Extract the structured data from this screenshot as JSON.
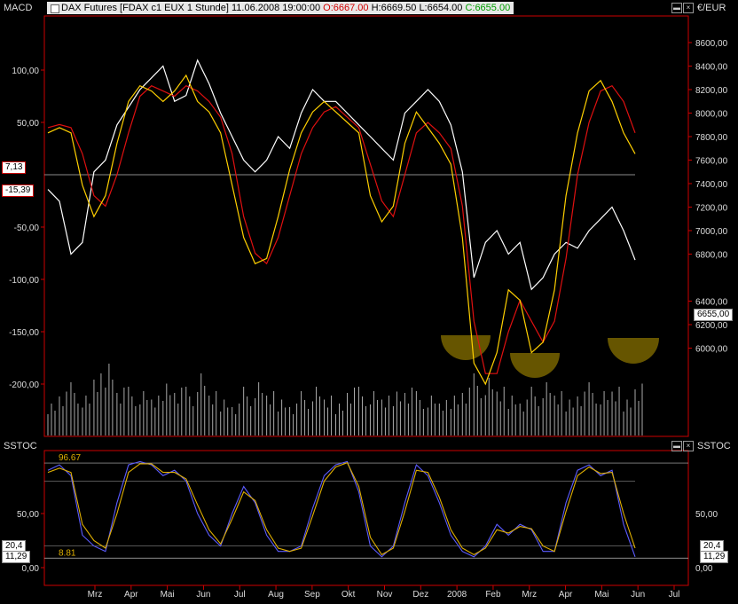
{
  "window": {
    "panel_top_label": "MACD",
    "panel_bottom_label": "SSTOC",
    "right_axis_label": "€/EUR",
    "right_bottom_label": "SSTOC"
  },
  "header": {
    "instrument": "DAX Futures [FDAX c1 EUX  1 Stunde]",
    "datetime": "11.06.2008 19:00:00",
    "open": "O:6667.00",
    "high": "H:6669.50",
    "low": "L:6654.00",
    "close": "C:6655.00"
  },
  "colors": {
    "price": "#ffffff",
    "macd": "#ffd000",
    "signal": "#e01010",
    "stoch_k": "#5b5bff",
    "stoch_d": "#e0b000",
    "highlight": "#6b5a00"
  },
  "tags": {
    "macd_value": "7,13",
    "signal_value": "-15,39",
    "last_price": "6655,00",
    "stoch_a_left": "20,4",
    "stoch_b_left": "11,29",
    "stoch_a_right": "20,4",
    "stoch_b_right": "11,29",
    "upper_level": "96.67",
    "lower_level": "8.81"
  },
  "chart_data": [
    {
      "type": "line",
      "panel": "MACD",
      "left_axis": {
        "ticks": [
          "100,00",
          "50,00",
          "-50,00",
          "-100,00",
          "-150,00",
          "-200,00"
        ],
        "values": [
          100,
          50,
          -50,
          -100,
          -150,
          -200
        ]
      },
      "right_axis": {
        "label": "€/EUR",
        "ticks": [
          "8600,00",
          "8400,00",
          "8200,00",
          "8000,00",
          "7800,00",
          "7600,00",
          "7400,00",
          "7200,00",
          "7000,00",
          "6800,00",
          "6400,00",
          "6200,00",
          "6000,00"
        ],
        "values": [
          8600,
          8400,
          8200,
          8000,
          7800,
          7600,
          7400,
          7200,
          7000,
          6800,
          6400,
          6200,
          6000
        ]
      },
      "x": [
        "Mrz",
        "Apr",
        "Mai",
        "Jun",
        "Jul",
        "Aug",
        "Sep",
        "Okt",
        "Nov",
        "Dez",
        "2008",
        "Feb",
        "Mrz",
        "Apr",
        "Mai",
        "Jun",
        "Jul"
      ],
      "series": [
        {
          "role": "price",
          "values": [
            7350,
            7250,
            6800,
            6900,
            7500,
            7600,
            7900,
            8050,
            8200,
            8300,
            8400,
            8100,
            8150,
            8450,
            8250,
            8000,
            7800,
            7600,
            7500,
            7600,
            7800,
            7700,
            8000,
            8200,
            8100,
            8100,
            8000,
            7900,
            7800,
            7700,
            7600,
            8000,
            8100,
            8200,
            8100,
            7900,
            7500,
            6600,
            6900,
            7000,
            6800,
            6900,
            6500,
            6600,
            6800,
            6900,
            6850,
            7000,
            7100,
            7200,
            7000,
            6750
          ]
        },
        {
          "role": "macd",
          "values": [
            40,
            45,
            40,
            -10,
            -40,
            -20,
            30,
            70,
            85,
            80,
            70,
            80,
            95,
            70,
            60,
            40,
            -10,
            -60,
            -85,
            -80,
            -40,
            5,
            40,
            60,
            70,
            60,
            50,
            40,
            -20,
            -45,
            -30,
            30,
            60,
            45,
            30,
            10,
            -60,
            -180,
            -200,
            -170,
            -110,
            -120,
            -170,
            -160,
            -110,
            -20,
            40,
            80,
            90,
            70,
            40,
            20
          ]
        },
        {
          "role": "signal",
          "values": [
            45,
            48,
            45,
            20,
            -20,
            -30,
            0,
            40,
            75,
            85,
            80,
            75,
            85,
            80,
            70,
            55,
            20,
            -40,
            -75,
            -85,
            -60,
            -20,
            20,
            45,
            60,
            65,
            55,
            45,
            10,
            -25,
            -40,
            0,
            40,
            50,
            40,
            25,
            -30,
            -140,
            -190,
            -190,
            -150,
            -120,
            -140,
            -160,
            -140,
            -80,
            0,
            50,
            80,
            85,
            70,
            40
          ]
        }
      ]
    },
    {
      "type": "line",
      "panel": "SSTOC",
      "axis": {
        "ticks": [
          "50,00",
          "0,00"
        ],
        "values": [
          50,
          0
        ]
      },
      "levels": [
        96.67,
        8.81
      ],
      "series": [
        {
          "role": "k",
          "values": [
            90,
            95,
            85,
            30,
            20,
            15,
            60,
            95,
            98,
            95,
            85,
            90,
            80,
            50,
            30,
            20,
            50,
            75,
            60,
            30,
            15,
            15,
            20,
            55,
            85,
            95,
            98,
            70,
            20,
            10,
            20,
            60,
            95,
            85,
            60,
            30,
            15,
            10,
            20,
            40,
            30,
            40,
            35,
            15,
            15,
            60,
            90,
            95,
            85,
            90,
            40,
            10
          ]
        },
        {
          "role": "d",
          "values": [
            88,
            92,
            88,
            40,
            25,
            18,
            50,
            88,
            96,
            96,
            88,
            88,
            82,
            58,
            35,
            22,
            45,
            70,
            62,
            35,
            18,
            15,
            18,
            48,
            80,
            93,
            97,
            75,
            28,
            12,
            18,
            52,
            90,
            88,
            65,
            35,
            18,
            12,
            18,
            35,
            32,
            38,
            36,
            20,
            15,
            52,
            85,
            93,
            87,
            88,
            50,
            18
          ]
        }
      ]
    },
    {
      "type": "bar",
      "panel": "Volume",
      "values": [
        40,
        55,
        60,
        45,
        70,
        90,
        60,
        55,
        50,
        45,
        65,
        60,
        55,
        70,
        50,
        45,
        40,
        55,
        60,
        50,
        45,
        40,
        50,
        55,
        45,
        40,
        60,
        55,
        50,
        45,
        55,
        60,
        50,
        45,
        40,
        50,
        60,
        70,
        65,
        55,
        50,
        45,
        55,
        60,
        50,
        45,
        55,
        60,
        50,
        55,
        45,
        65
      ]
    }
  ]
}
